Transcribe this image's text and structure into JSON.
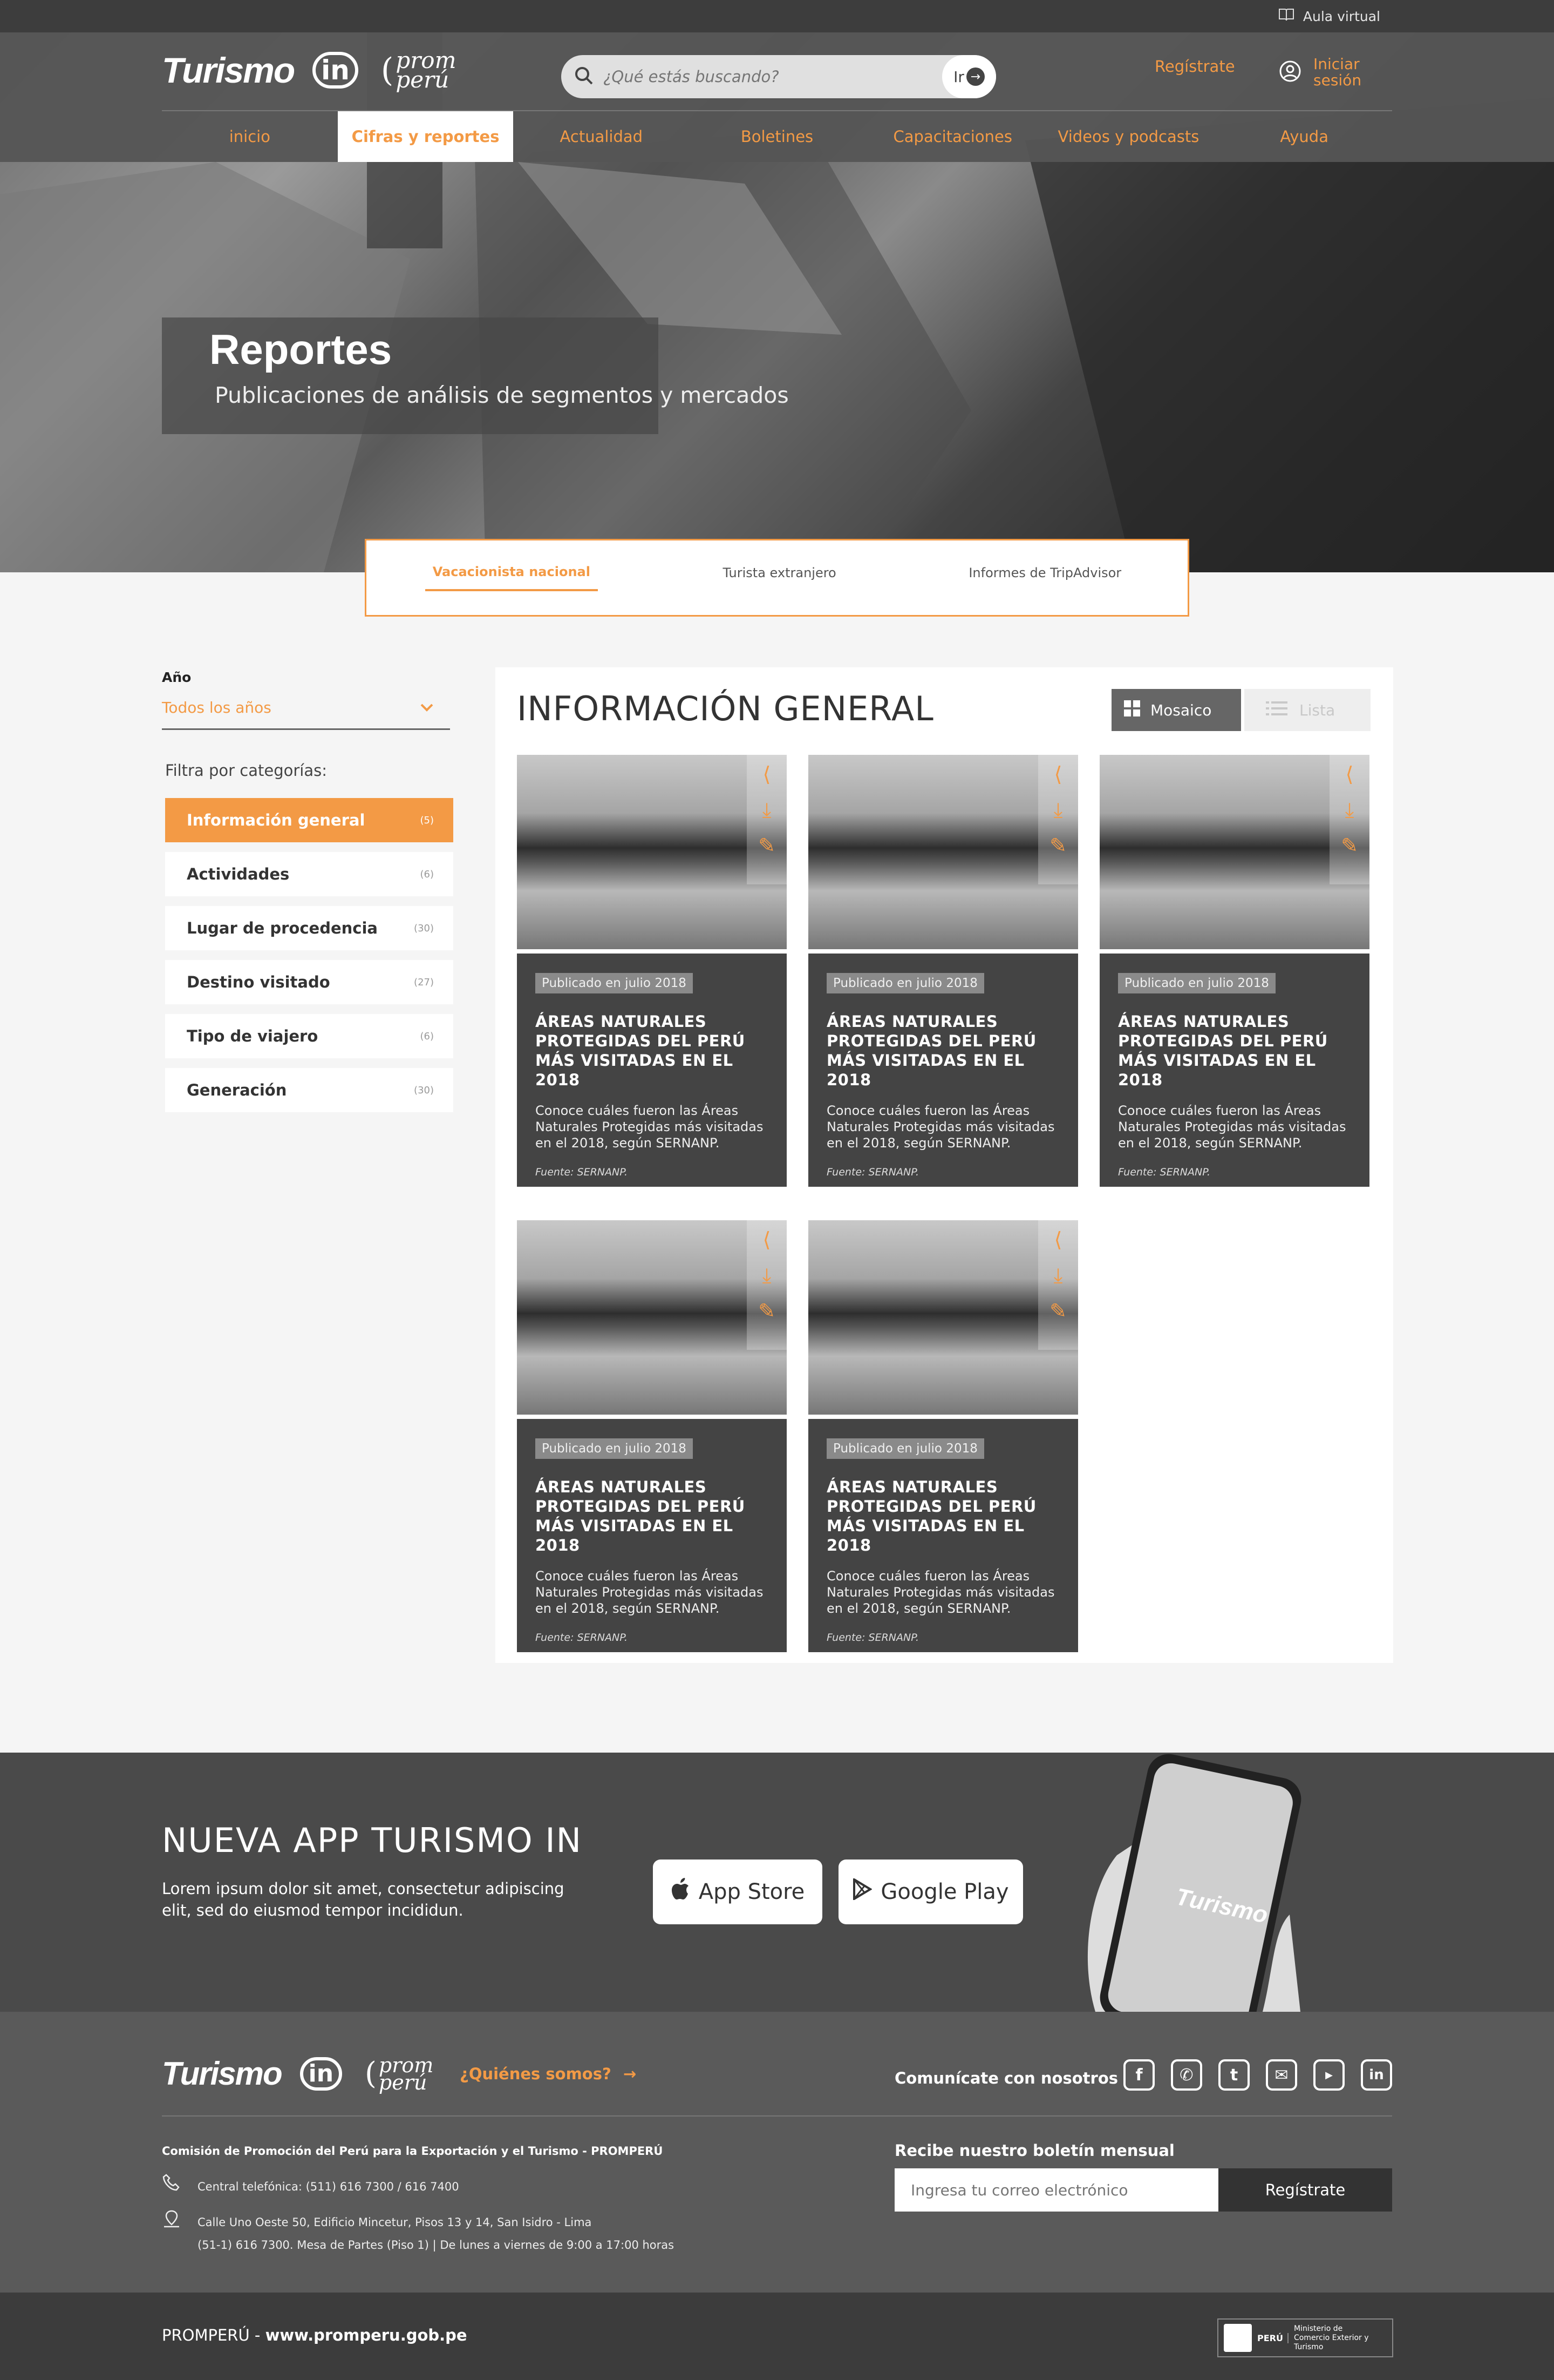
{
  "topbar": {
    "aula_label": "Aula virtual"
  },
  "brand": {
    "turismo": "Turismo",
    "in": "in",
    "prom": "prom",
    "peru": "perú"
  },
  "search": {
    "placeholder": "¿Qué estás buscando?",
    "button": "Ir"
  },
  "header": {
    "register": "Regístrate",
    "login_line1": "Iniciar",
    "login_line2": "sesión"
  },
  "nav": [
    "inicio",
    "Cifras y reportes",
    "Actualidad",
    "Boletines",
    "Capacitaciones",
    "Videos y podcasts",
    "Ayuda"
  ],
  "hero": {
    "title": "Reportes",
    "subtitle": "Publicaciones de análisis de segmentos y mercados"
  },
  "tabs": [
    "Vacacionista nacional",
    "Turista extranjero",
    "Informes de TripAdvisor"
  ],
  "filters": {
    "year_label": "Año",
    "year_value": "Todos los años",
    "categories_label": "Filtra por categorías:",
    "categories": [
      {
        "label": "Información general",
        "count": "(5)"
      },
      {
        "label": "Actividades",
        "count": "(6)"
      },
      {
        "label": "Lugar de procedencia",
        "count": "(30)"
      },
      {
        "label": "Destino visitado",
        "count": "(27)"
      },
      {
        "label": "Tipo de viajero",
        "count": "(6)"
      },
      {
        "label": "Generación",
        "count": "(30)"
      }
    ]
  },
  "main": {
    "title": "INFORMACIÓN GENERAL",
    "view_mosaic": "Mosaico",
    "view_list": "Lista"
  },
  "cards": [
    {
      "badge": "Publicado en julio 2018",
      "title": "ÁREAS NATURALES PROTEGIDAS DEL PERÚ MÁS VISITADAS EN EL 2018",
      "desc": "Conoce cuáles fueron las Áreas Naturales Protegidas más visitadas en el 2018, según SERNANP.",
      "source": "Fuente:  SERNANP."
    },
    {
      "badge": "Publicado en julio 2018",
      "title": "ÁREAS NATURALES PROTEGIDAS DEL PERÚ MÁS VISITADAS EN EL 2018",
      "desc": "Conoce cuáles fueron las Áreas Naturales Protegidas más visitadas en el 2018, según SERNANP.",
      "source": "Fuente:  SERNANP."
    },
    {
      "badge": "Publicado en julio 2018",
      "title": "ÁREAS NATURALES PROTEGIDAS DEL PERÚ MÁS VISITADAS EN EL 2018",
      "desc": "Conoce cuáles fueron las Áreas Naturales Protegidas más visitadas en el 2018, según SERNANP.",
      "source": "Fuente:  SERNANP."
    },
    {
      "badge": "Publicado en julio 2018",
      "title": "ÁREAS NATURALES PROTEGIDAS DEL PERÚ MÁS VISITADAS EN EL 2018",
      "desc": "Conoce cuáles fueron las Áreas Naturales Protegidas más visitadas en el 2018, según SERNANP.",
      "source": "Fuente:  SERNANP."
    },
    {
      "badge": "Publicado en julio 2018",
      "title": "ÁREAS NATURALES PROTEGIDAS DEL PERÚ MÁS VISITADAS EN EL 2018",
      "desc": "Conoce cuáles fueron las Áreas Naturales Protegidas más visitadas en el 2018, según SERNANP.",
      "source": "Fuente:  SERNANP."
    }
  ],
  "app": {
    "title": "NUEVA APP TURISMO IN",
    "text": "Lorem ipsum dolor sit amet, consectetur adipiscing elit, sed do eiusmod tempor incididun.",
    "appstore": "App Store",
    "googleplay": "Google Play"
  },
  "footer": {
    "quienes": "¿Quiénes somos?",
    "contact_label": "Comunícate con nosotros",
    "social": [
      "facebook-icon",
      "whatsapp-icon",
      "twitter-icon",
      "mail-icon",
      "youtube-icon",
      "linkedin-icon"
    ],
    "org": "Comisión de Promoción del Perú para la Exportación y el Turismo - PROMPERÚ",
    "phone": "Central telefónica: (511) 616 7300 / 616 7400",
    "address1": "Calle Uno Oeste 50, Edificio Mincetur, Pisos 13 y 14, San Isidro - Lima",
    "address2": "(51-1) 616 7300. Mesa de Partes (Piso 1) | De lunes a viernes de 9:00 a 17:00 horas",
    "newsletter_label": "Recibe nuestro boletín mensual",
    "email_placeholder": "Ingresa tu correo electrónico",
    "newsletter_button": "Regístrate",
    "copyright_prefix": "PROMPERÚ - ",
    "website": "www.promperu.gob.pe",
    "ministerio_badge": "PERÚ",
    "ministerio": "Ministerio de Comercio Exterior y Turismo"
  },
  "colors": {
    "accent": "#f39a45",
    "dark": "#3d3d3d",
    "card": "#444444"
  }
}
